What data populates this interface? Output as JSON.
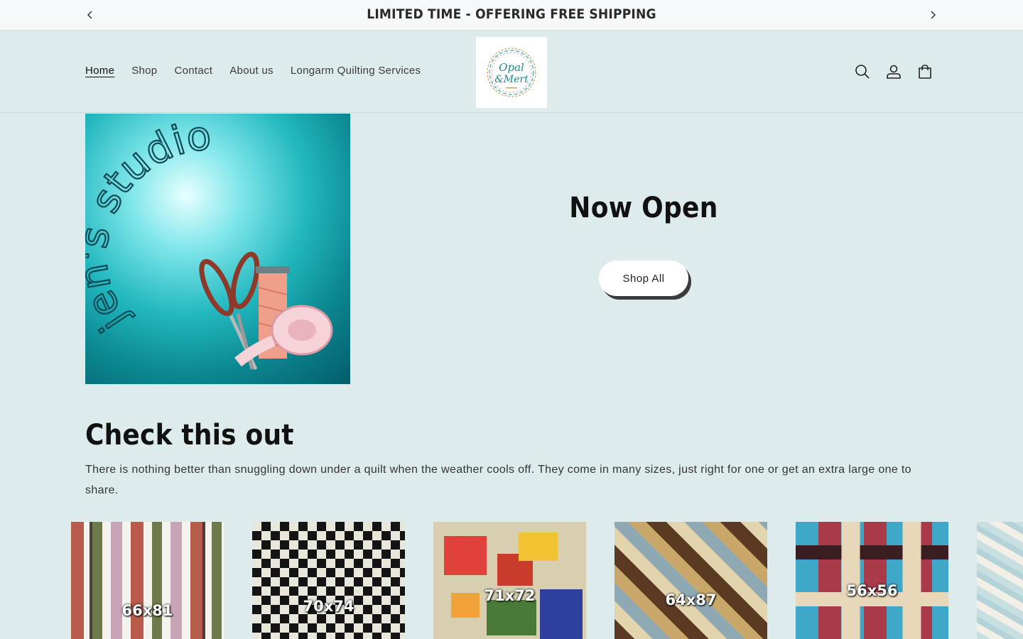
{
  "announcement": {
    "text": "LIMITED TIME - OFFERING FREE SHIPPING"
  },
  "nav": {
    "items": [
      {
        "label": "Home",
        "active": true
      },
      {
        "label": "Shop"
      },
      {
        "label": "Contact"
      },
      {
        "label": "About us"
      },
      {
        "label": "Longarm Quilting Services"
      }
    ]
  },
  "logo": {
    "text_line1": "Opal",
    "text_line2": "&Mert"
  },
  "header_icons": [
    "search-icon",
    "account-icon",
    "cart-icon"
  ],
  "hero": {
    "image_text": "jen's studio",
    "title": "Now Open",
    "button_label": "Shop All"
  },
  "section": {
    "title": "Check this out",
    "text": "There is nothing better than snuggling down under a quilt when the weather cools off. They come in many sizes, just right for one or get an extra large one to share."
  },
  "products": [
    {
      "size": "66x81"
    },
    {
      "size": "70x74"
    },
    {
      "size": "71x72"
    },
    {
      "size": "64x87"
    },
    {
      "size": "56x56"
    },
    {
      "size": ""
    }
  ],
  "colors": {
    "background": "#ddebec",
    "announcement_bg": "#f7f8f9",
    "hero_teal": "#22b8bf",
    "text": "#121212"
  }
}
